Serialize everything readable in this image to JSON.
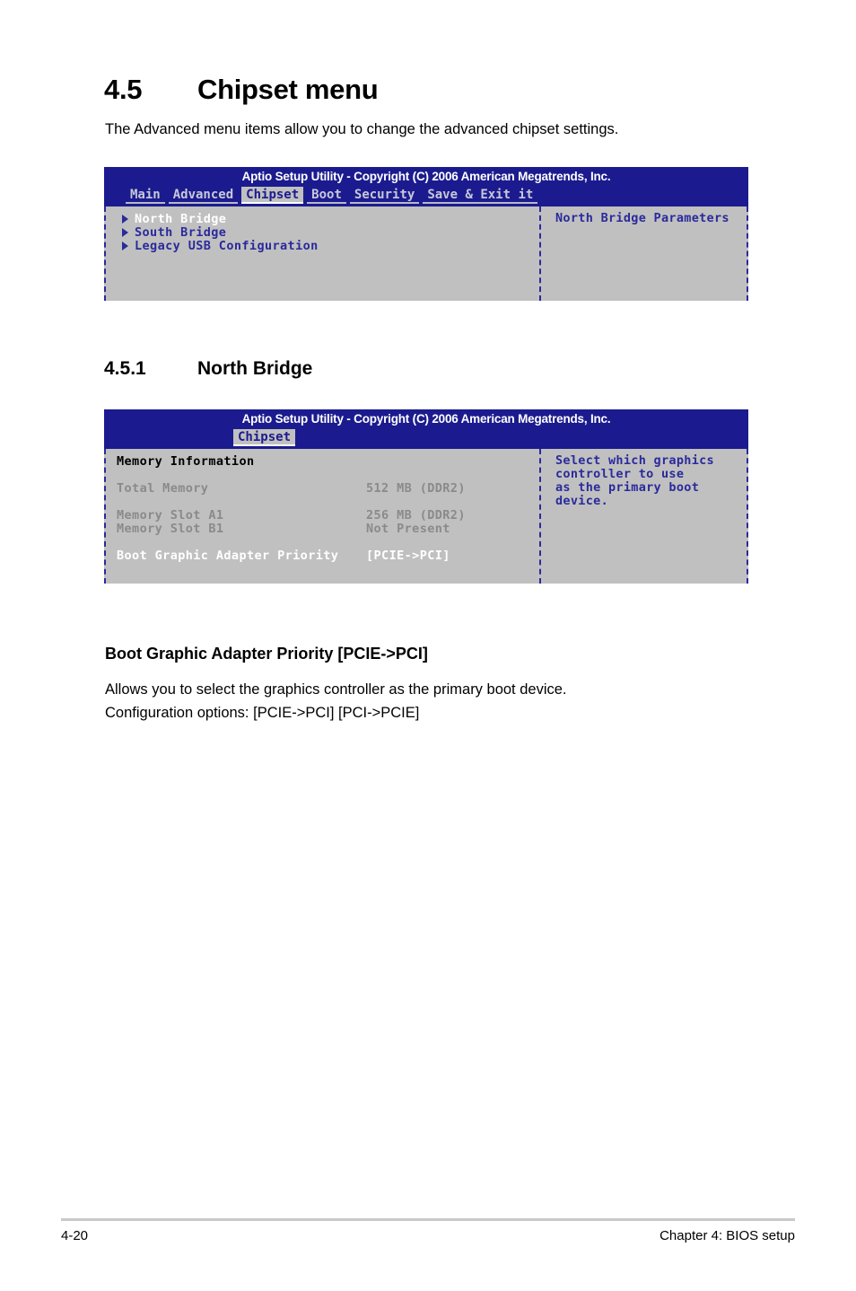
{
  "section": {
    "number": "4.5",
    "title": "Chipset menu",
    "intro": "The Advanced menu items allow you to change the advanced chipset settings."
  },
  "subsection": {
    "number": "4.5.1",
    "title": "North Bridge"
  },
  "bios_chipset": {
    "titlebar": "Aptio Setup Utility - Copyright (C) 2006 American Megatrends, Inc.",
    "menu": [
      {
        "label": "Main",
        "active": false
      },
      {
        "label": "Advanced",
        "active": false
      },
      {
        "label": "Chipset",
        "active": true
      },
      {
        "label": "Boot",
        "active": false
      },
      {
        "label": "Security",
        "active": false
      },
      {
        "label": "Save & Exit it",
        "active": false
      }
    ],
    "nav_items": [
      {
        "label": "North Bridge",
        "selected": true
      },
      {
        "label": "South Bridge",
        "selected": false
      },
      {
        "label": "Legacy USB Configuration",
        "selected": false
      }
    ],
    "help": "North Bridge Parameters"
  },
  "bios_northbridge": {
    "titlebar": "Aptio Setup Utility - Copyright (C) 2006 American Megatrends, Inc.",
    "menu": [
      {
        "label": "Chipset",
        "active": true
      }
    ],
    "rows": [
      {
        "label": "Memory Information",
        "value": "",
        "style": "section"
      },
      {
        "label": "",
        "value": "",
        "style": "spacer"
      },
      {
        "label": "Total Memory",
        "value": "512 MB (DDR2)",
        "style": "dim"
      },
      {
        "label": "",
        "value": "",
        "style": "spacer"
      },
      {
        "label": "Memory Slot A1",
        "value": "256 MB (DDR2)",
        "style": "dim"
      },
      {
        "label": "Memory Slot B1",
        "value": "Not Present",
        "style": "dim"
      },
      {
        "label": "",
        "value": "",
        "style": "spacer"
      },
      {
        "label": "Boot Graphic Adapter Priority",
        "value": "[PCIE->PCI]",
        "style": "selected"
      }
    ],
    "help_lines": [
      "Select which graphics",
      "controller to use",
      "as the primary boot",
      "device."
    ]
  },
  "option_doc": {
    "heading": "Boot Graphic Adapter Priority [PCIE->PCI]",
    "line1": "Allows you to select the graphics controller as the primary boot device.",
    "line2": "Configuration options:  [PCIE->PCI] [PCI->PCIE]"
  },
  "footer": {
    "page_number": "4-20",
    "chapter": "Chapter 4: BIOS setup"
  },
  "colors": {
    "bios_blue": "#1b1b8f",
    "bios_text_blue": "#2a2a9c",
    "bios_gray": "#c0c0c0",
    "dim_text": "#8a8a8a"
  }
}
